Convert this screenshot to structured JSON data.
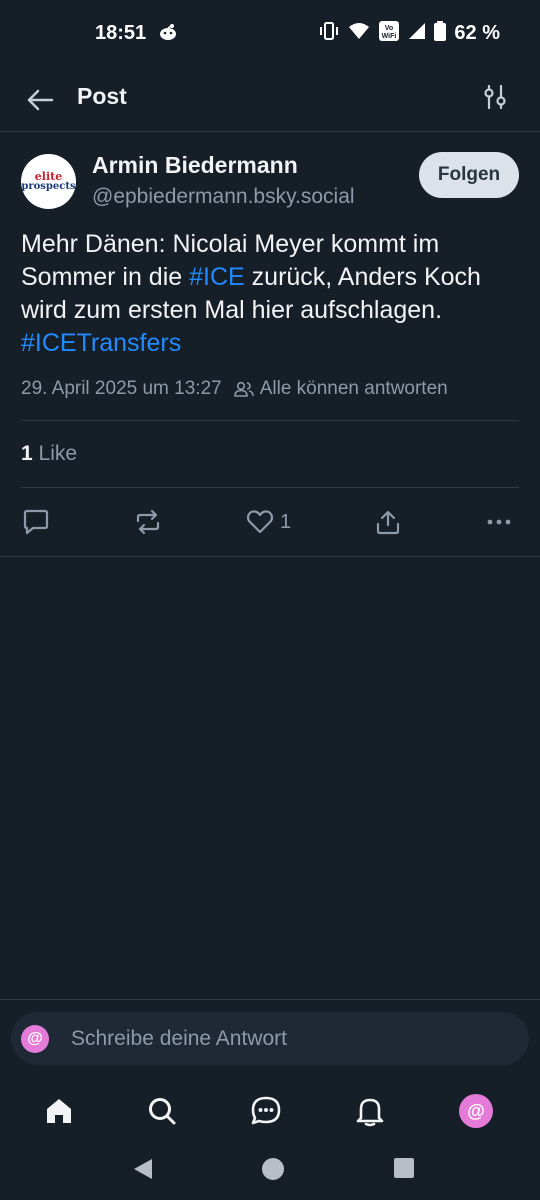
{
  "status_bar": {
    "time": "18:51",
    "battery_text": "62 %",
    "wifi_label": "Vo WiFi"
  },
  "header": {
    "title": "Post"
  },
  "post": {
    "author_name": "Armin Biedermann",
    "author_handle": "@epbiedermann.bsky.social",
    "avatar_text_top": "elite",
    "avatar_text_bottom": "prospects",
    "follow_label": "Folgen",
    "text_part1": "Mehr Dänen: Nicolai Meyer kommt im Sommer in die ",
    "hashtag1": "#ICE",
    "text_part2": " zurück, Anders Koch wird zum ersten Mal hier aufschlagen. ",
    "hashtag2": "#ICETransfers",
    "date": "29. April 2025 um 13:27",
    "reply_permission": "Alle können antworten",
    "like_count": "1",
    "like_label": "Like",
    "actions": {
      "like_count": "1"
    }
  },
  "reply_bar": {
    "placeholder": "Schreibe deine Antwort",
    "at_symbol": "@"
  },
  "bottom_nav": {
    "profile_symbol": "@"
  },
  "colors": {
    "background": "#161e27",
    "accent_link": "#208bfe",
    "muted_text": "#8d9aa9",
    "follow_button_bg": "#dce2ea",
    "profile_avatar": "#e47bd8"
  }
}
